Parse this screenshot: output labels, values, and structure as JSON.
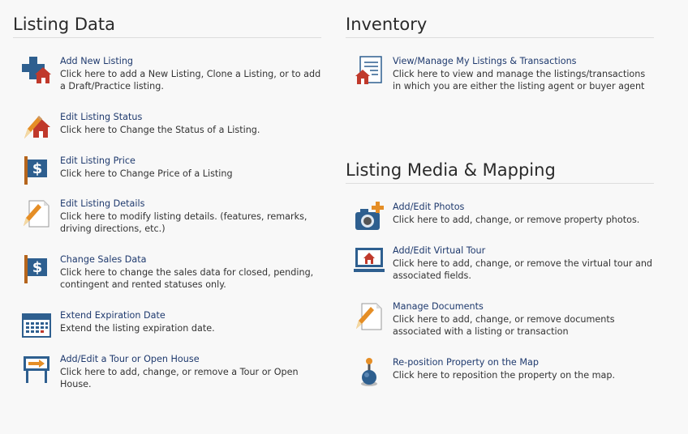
{
  "listing_data": {
    "title": "Listing Data",
    "items": [
      {
        "icon": "add-house-icon",
        "link": "Add New Listing",
        "desc": "Click here to add a New Listing, Clone a Listing, or to add a Draft/Practice listing."
      },
      {
        "icon": "edit-house-pencil-icon",
        "link": "Edit Listing Status",
        "desc": "Click here to Change the Status of a Listing."
      },
      {
        "icon": "price-sign-icon",
        "link": "Edit Listing Price",
        "desc": "Click here to Change Price of a Listing"
      },
      {
        "icon": "document-pencil-icon",
        "link": "Edit Listing Details",
        "desc": "Click here to modify listing details. (features, remarks, driving directions, etc.)"
      },
      {
        "icon": "price-sign-icon",
        "link": "Change Sales Data",
        "desc": "Click here to change the sales data for closed, pending, contingent and rented statuses only."
      },
      {
        "icon": "calendar-icon",
        "link": "Extend Expiration Date",
        "desc": "Extend the listing expiration date."
      },
      {
        "icon": "directional-sign-icon",
        "link": "Add/Edit a Tour or Open House",
        "desc": "Click here to add, change, or remove a Tour or Open House."
      }
    ]
  },
  "inventory": {
    "title": "Inventory",
    "items": [
      {
        "icon": "listing-document-house-icon",
        "link": "View/Manage My Listings & Transactions",
        "desc": "Click here to view and manage the listings/transactions in which you are either the listing agent or buyer agent"
      }
    ]
  },
  "media": {
    "title": "Listing Media & Mapping",
    "items": [
      {
        "icon": "camera-add-icon",
        "link": "Add/Edit Photos",
        "desc": "Click here to add, change, or remove property photos."
      },
      {
        "icon": "monitor-house-icon",
        "link": "Add/Edit Virtual Tour",
        "desc": "Click here to add, change, or remove the virtual tour and associated fields."
      },
      {
        "icon": "document-pencil-icon",
        "link": "Manage Documents",
        "desc": "Click here to add, change, or remove documents associated with a listing or transaction"
      },
      {
        "icon": "map-pin-icon",
        "link": "Re-position Property on the Map",
        "desc": "Click here to reposition the property on the map."
      }
    ]
  }
}
